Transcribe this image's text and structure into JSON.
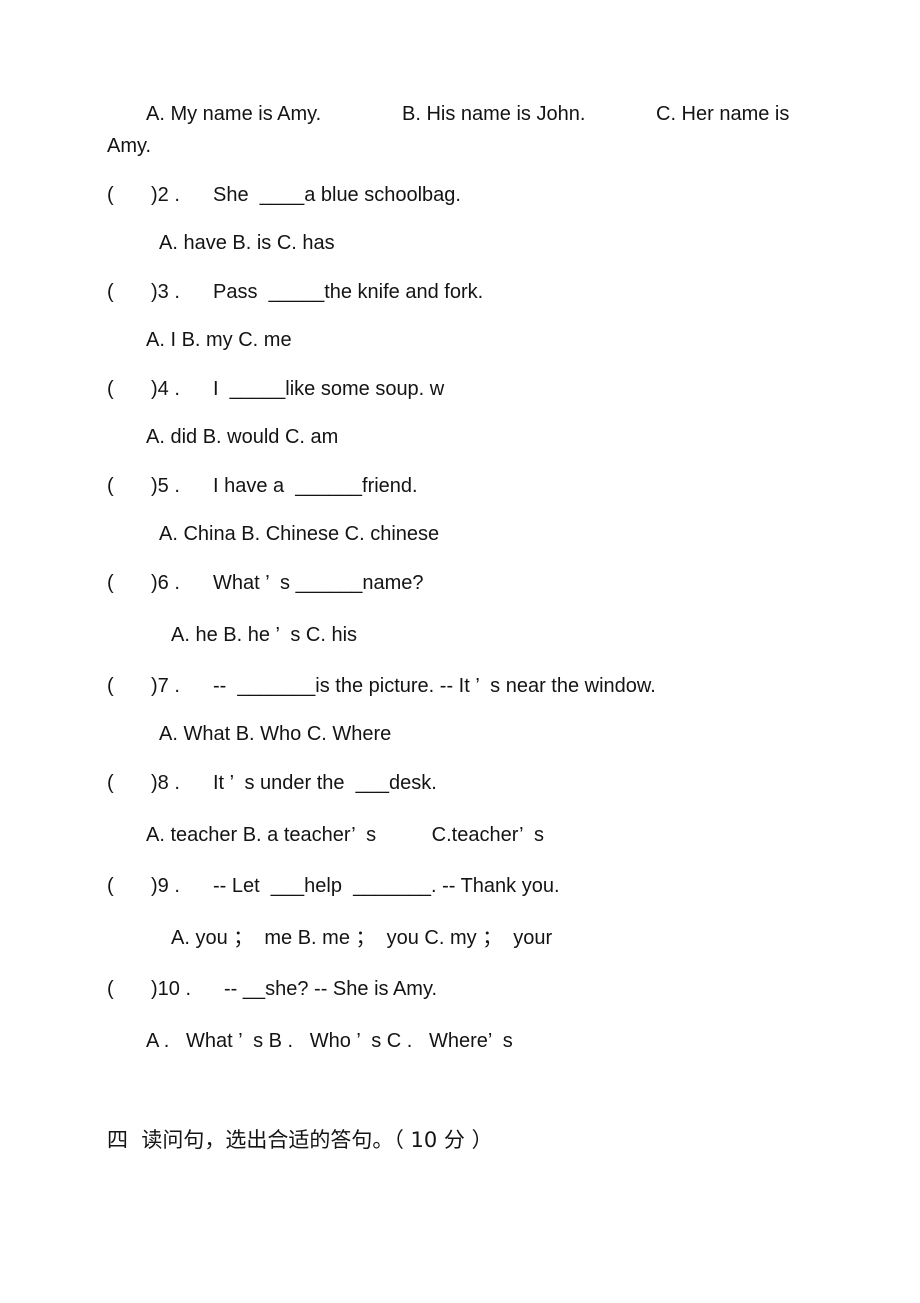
{
  "q1_options": {
    "a": "A. My name is Amy.",
    "b": "B. His name is John.",
    "c": "C. Her name is",
    "c_wrap": "Amy."
  },
  "questions": [
    {
      "paren": "(",
      "num": ")2 .",
      "text": "She  ____a blue schoolbag.",
      "options": "A. have B. is C. has"
    },
    {
      "paren": "(",
      "num": ")3 .",
      "text": "Pass  _____the knife and fork.",
      "options": "A. I B. my C. me"
    },
    {
      "paren": "(",
      "num": ")4 .",
      "text": "I  _____like some soup. w",
      "options": "A. did B. would C. am"
    },
    {
      "paren": "(",
      "num": ")5 .",
      "text": "I have a  ______friend.",
      "options": "A. China B. Chinese C. chinese"
    },
    {
      "paren": "(",
      "num": ")6 .",
      "text": "What ’  s ______name?",
      "options": "A. he B. he ’  s C. his"
    },
    {
      "paren": "(",
      "num": ")7 .",
      "text": "--  _______is the picture. -- It ’  s near the window.",
      "options": "A. What B. Who C. Where"
    },
    {
      "paren": "(",
      "num": ")8 .",
      "text": "It ’  s under the  ___desk.",
      "options": "A. teacher B. a teacher’  s          C.teacher’  s"
    },
    {
      "paren": "(",
      "num": ")9 .",
      "text": "-- Let  ___help  _______. -- Thank you.",
      "options": "A. you ；  me B. me ；  you C. my ；  your"
    },
    {
      "paren": "(",
      "num": ")10 .",
      "text": "-- __she? -- She is Amy.",
      "options": "A .   What ’  s B .   Who ’  s C .   Where’  s"
    }
  ],
  "section4": {
    "title": "四  读问句，选出合适的答句。（ 10 分 ）"
  }
}
